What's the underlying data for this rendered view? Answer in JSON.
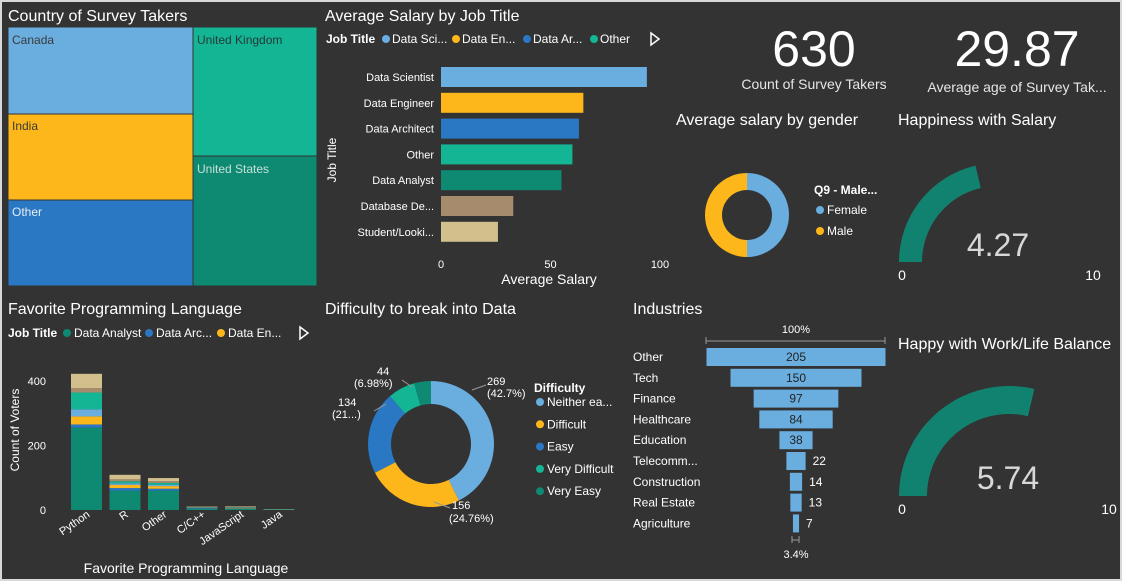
{
  "colors": {
    "blue_light": "#6aaee0",
    "yellow": "#fdb71b",
    "blue_mid": "#2a77c3",
    "teal": "#14b594",
    "teal_dark": "#0f8a72",
    "tan": "#a68c6d",
    "beige": "#d1c08c",
    "gauge": "#128270",
    "background": "#333333",
    "text": "#ffffff"
  },
  "treemap": {
    "title": "Country of Survey Takers",
    "cells": [
      "Canada",
      "India",
      "Other",
      "United Kingdom",
      "United States"
    ]
  },
  "salary_chart": {
    "title": "Average Salary by Job Title",
    "legend_title": "Job Title",
    "legend_items": [
      "Data Sci...",
      "Data En...",
      "Data Ar...",
      "Other"
    ],
    "xlabel": "Average Salary",
    "ylabel": "Job Title"
  },
  "kpi": {
    "count_value": "630",
    "count_label": "Count of Survey Takers",
    "age_value": "29.87",
    "age_label": "Average age of Survey Tak..."
  },
  "gender_chart": {
    "title": "Average salary by gender",
    "legend_title": "Q9 - Male...",
    "legend_items": [
      "Female",
      "Male"
    ]
  },
  "happiness_salary": {
    "title": "Happiness with Salary",
    "value_label": "4.27",
    "min_label": "0",
    "max_label": "10"
  },
  "programming_chart": {
    "title": "Favorite Programming Language",
    "legend_title": "Job Title",
    "legend_items": [
      "Data Analyst",
      "Data Arc...",
      "Data En..."
    ],
    "xlabel": "Favorite Programming Language",
    "ylabel": "Count of Voters"
  },
  "difficulty_chart": {
    "title": "Difficulty to break into Data",
    "legend_title": "Difficulty",
    "legend_items": [
      "Neither ea...",
      "Difficult",
      "Easy",
      "Very Difficult",
      "Very Easy"
    ]
  },
  "industries_chart": {
    "title": "Industries",
    "top_label": "100%",
    "bottom_label": "3.4%"
  },
  "worklife": {
    "title": "Happy with Work/Life Balance",
    "value_label": "5.74",
    "min_label": "0",
    "max_label": "10"
  },
  "chart_data": [
    {
      "id": "salary",
      "type": "bar",
      "orientation": "horizontal",
      "categories": [
        "Data Scientist",
        "Data Engineer",
        "Data Architect",
        "Other",
        "Data Analyst",
        "Database De...",
        "Student/Looki..."
      ],
      "values": [
        94,
        65,
        63,
        60,
        55,
        33,
        26
      ],
      "colors": [
        "#6aaee0",
        "#fdb71b",
        "#2a77c3",
        "#14b594",
        "#0f8a72",
        "#a68c6d",
        "#d1c08c"
      ],
      "ticks": [
        0,
        50,
        100
      ],
      "xlim": [
        0,
        100
      ]
    },
    {
      "id": "gender",
      "type": "pie",
      "categories": [
        "Female",
        "Male"
      ],
      "values": [
        50,
        50
      ],
      "colors": [
        "#6aaee0",
        "#fdb71b"
      ]
    },
    {
      "id": "happiness_salary",
      "type": "gauge",
      "value": 4.27,
      "min": 0,
      "max": 10
    },
    {
      "id": "programming",
      "type": "bar",
      "stacked": true,
      "categories": [
        "Python",
        "R",
        "Other",
        "C/C++",
        "JavaScript",
        "Java"
      ],
      "series": [
        {
          "name": "Data Analyst",
          "values": [
            255,
            60,
            60,
            4,
            4,
            2
          ]
        },
        {
          "name": "Data Arc...",
          "values": [
            10,
            8,
            6,
            2,
            1,
            0
          ]
        },
        {
          "name": "Data En...",
          "values": [
            25,
            10,
            8,
            1,
            1,
            0
          ]
        },
        {
          "values": [
            22,
            5,
            4,
            1,
            1,
            0
          ]
        },
        {
          "values": [
            52,
            6,
            6,
            1,
            1,
            0
          ]
        },
        {
          "values": [
            14,
            6,
            5,
            1,
            1,
            0
          ]
        },
        {
          "values": [
            44,
            14,
            10,
            1,
            2,
            1
          ]
        }
      ],
      "colors": [
        "#0f8a72",
        "#2a77c3",
        "#fdb71b",
        "#6aaee0",
        "#14b594",
        "#a68c6d",
        "#d1c08c"
      ],
      "ticks": [
        0,
        200,
        400
      ],
      "ylim": [
        0,
        440
      ]
    },
    {
      "id": "difficulty",
      "type": "pie",
      "categories": [
        "Neither ea...",
        "Difficult",
        "Easy",
        "Very Difficult",
        "Very Easy"
      ],
      "values": [
        269,
        156,
        134,
        44,
        27
      ],
      "colors": [
        "#6aaee0",
        "#fdb71b",
        "#2a77c3",
        "#14b594",
        "#0f8a72"
      ],
      "labels": [
        {
          "value": "269",
          "pct": "(42.7%)"
        },
        {
          "value": "156",
          "pct": "(24.76%)"
        },
        {
          "value": "134",
          "pct": "(21...)"
        },
        {
          "value": "44",
          "pct": "(6.98%)"
        }
      ]
    },
    {
      "id": "industries",
      "type": "bar",
      "subtype": "funnel",
      "categories": [
        "Other",
        "Tech",
        "Finance",
        "Healthcare",
        "Education",
        "Telecomm...",
        "Construction",
        "Real Estate",
        "Agriculture"
      ],
      "values": [
        205,
        150,
        97,
        84,
        38,
        22,
        14,
        13,
        7
      ],
      "color": "#6aaee0"
    },
    {
      "id": "worklife",
      "type": "gauge",
      "value": 5.74,
      "min": 0,
      "max": 10
    }
  ]
}
